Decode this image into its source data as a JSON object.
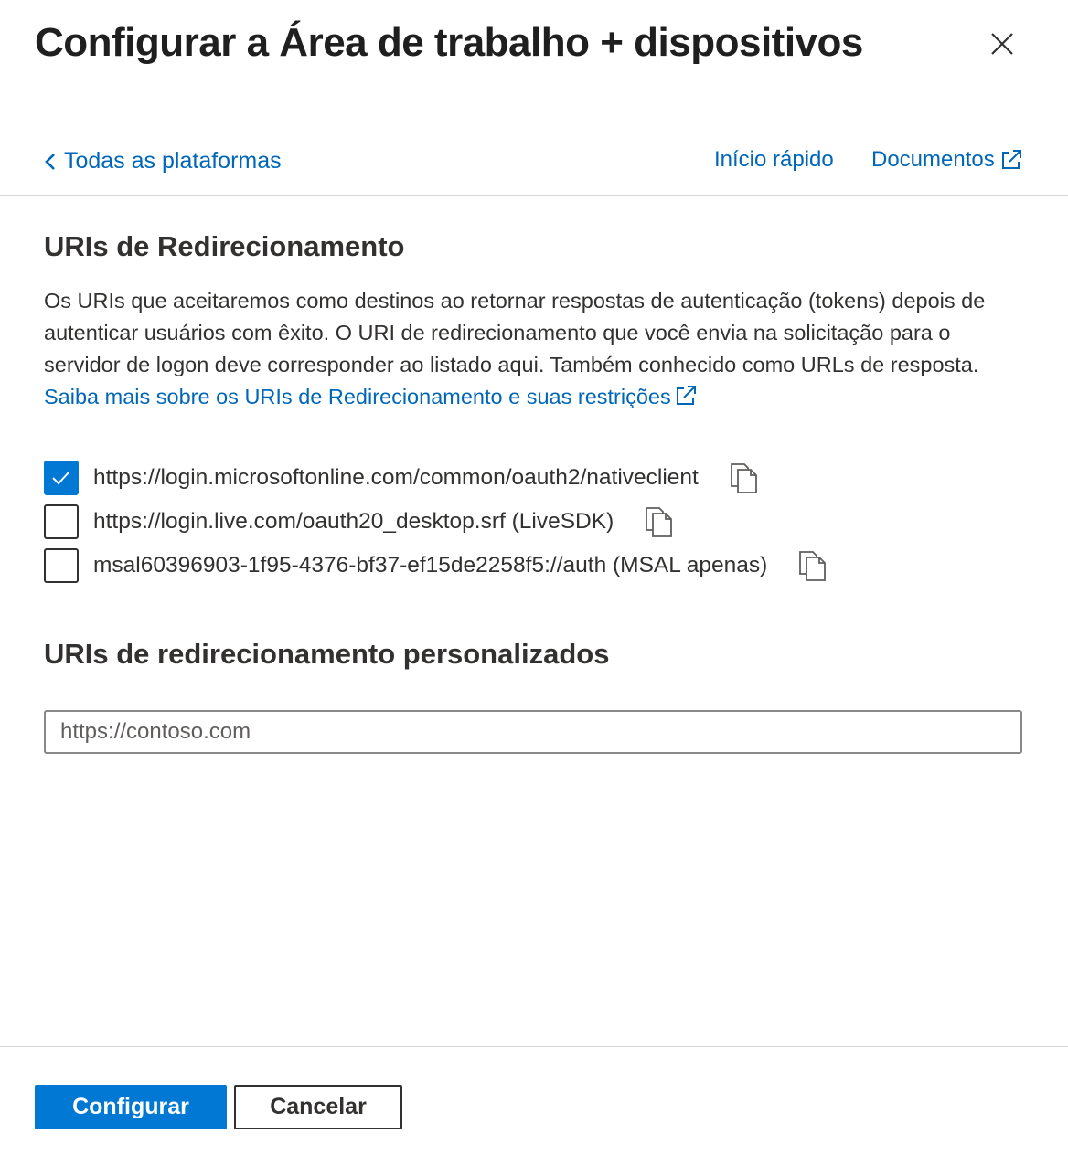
{
  "dialog": {
    "title": "Configurar a Área de trabalho + dispositivos"
  },
  "nav": {
    "back_label": "Todas as plataformas",
    "quickstart_label": "Início rápido",
    "docs_label": "Documentos"
  },
  "redirect_section": {
    "heading": "URIs de Redirecionamento",
    "description": "Os URIs que aceitaremos como destinos ao retornar respostas de autenticação (tokens) depois de autenticar usuários com êxito. O URI de redirecionamento que você envia na solicitação para o servidor de logon deve corresponder ao listado aqui. Também conhecido como URLs de resposta.",
    "learn_more_label": "Saiba mais sobre os URIs de Redirecionamento e suas restrições",
    "uris": [
      {
        "label": "https://login.microsoftonline.com/common/oauth2/nativeclient",
        "checked": true
      },
      {
        "label": "https://login.live.com/oauth20_desktop.srf (LiveSDK)",
        "checked": false
      },
      {
        "label": "msal60396903-1f95-4376-bf37-ef15de2258f5://auth (MSAL apenas)",
        "checked": false
      }
    ]
  },
  "custom_section": {
    "heading": "URIs de redirecionamento personalizados",
    "input_value": "",
    "input_placeholder": "https://contoso.com"
  },
  "footer": {
    "configure_label": "Configurar",
    "cancel_label": "Cancelar"
  },
  "colors": {
    "accent": "#0078d4",
    "link": "#0067b8",
    "text": "#323130"
  }
}
